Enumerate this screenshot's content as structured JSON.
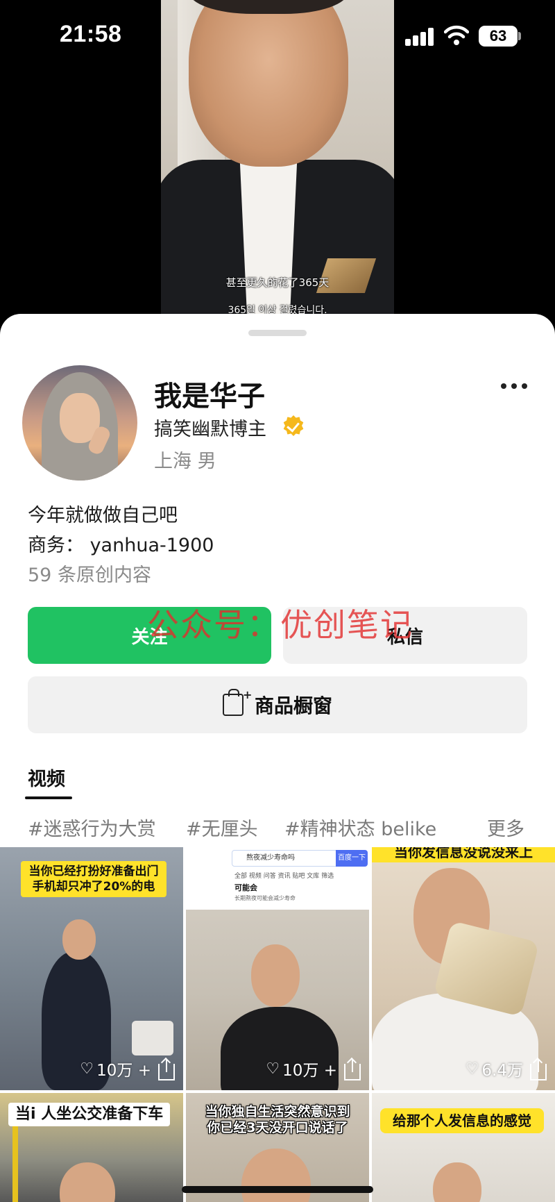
{
  "status_bar": {
    "time": "21:58",
    "battery": "63"
  },
  "video_top": {
    "subtitle_line1": "甚至更久的花了365天",
    "subtitle_line2": "365일 이상 걸렸습니다."
  },
  "profile": {
    "name": "我是华子",
    "tagline": "搞笑幽默博主",
    "location": "上海  男",
    "bio_line1": "今年就做做自己吧",
    "bio_line2": "商务：  yanhua-1900",
    "bio_line3": "59 条原创内容"
  },
  "actions": {
    "follow_label": "关注",
    "message_label": "私信",
    "shop_label": "商品橱窗"
  },
  "watermark": "公众号：优创笔记",
  "tabs": {
    "video_label": "视频"
  },
  "tags": [
    "#迷惑行为大赏",
    "#无厘头",
    "#精神状态 belike",
    "更多"
  ],
  "videos": [
    {
      "caption": "当你已经打扮好准备出门\n手机却只冲了20%的电",
      "likes": "10万 +"
    },
    {
      "search_query": "熬夜减少寿命吗",
      "search_button": "百度一下",
      "search_tabs": "全部   视频   问答   资讯   贴吧   文库   筛选",
      "search_result": "可能会",
      "search_sub": "长期熬夜可能会减少寿命",
      "likes": "10万 +"
    },
    {
      "caption": "当你发信息没说没来上",
      "likes": "6.4万"
    },
    {
      "caption": "当i 人坐公交准备下车"
    },
    {
      "caption": "当你独自生活突然意识到\n你已经3天没开口说话了"
    },
    {
      "caption": "给那个人发信息的感觉"
    }
  ],
  "colors": {
    "follow_green": "#20c262",
    "verified_gold": "#f5b81c",
    "caption_yellow": "#ffe22a",
    "watermark_red": "#e22d2d"
  }
}
